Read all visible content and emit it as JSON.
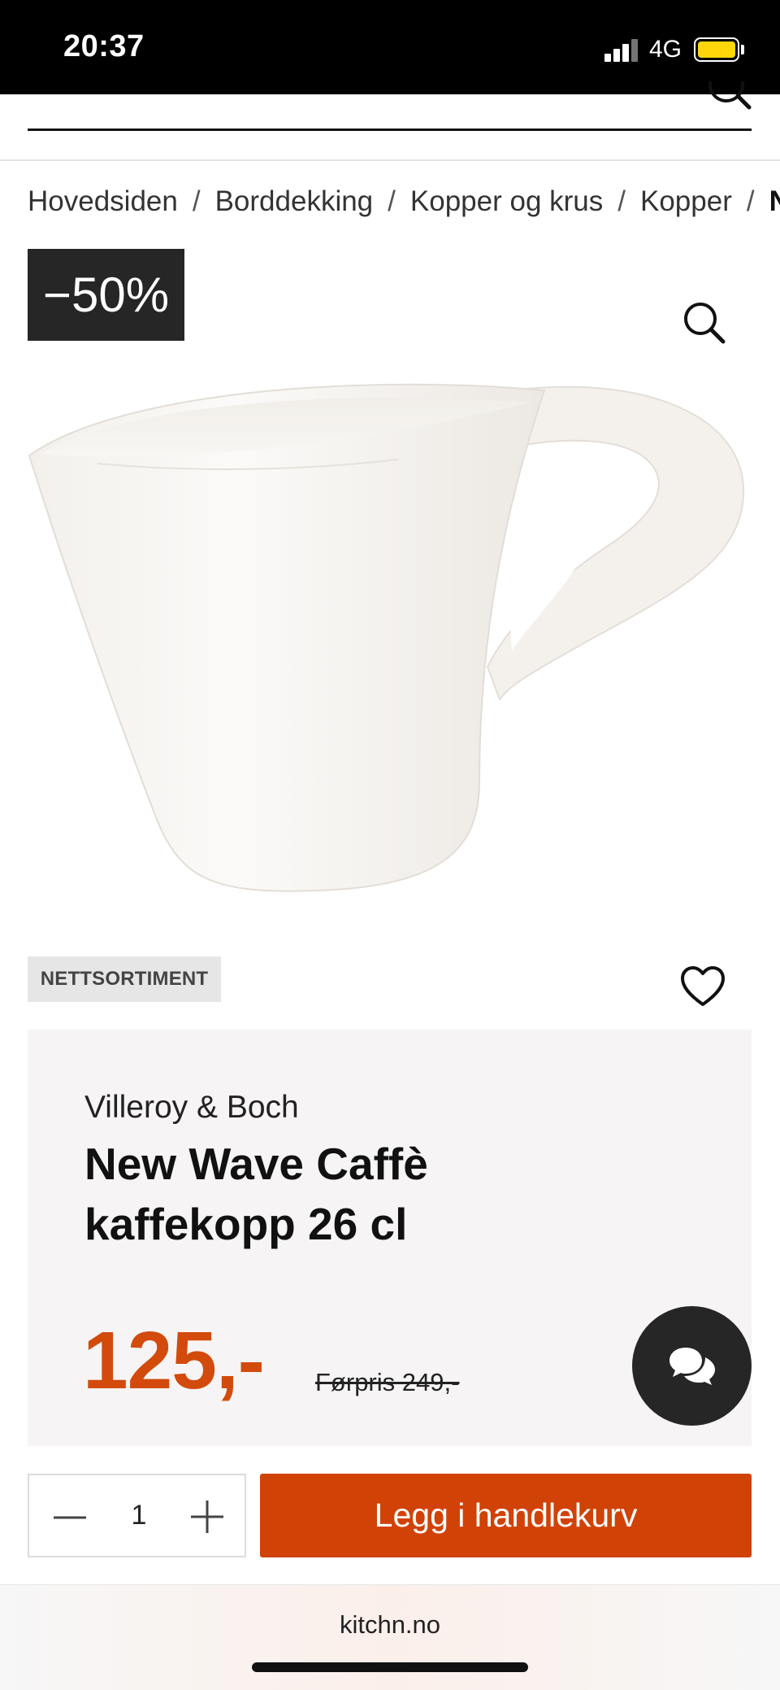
{
  "status_bar": {
    "time": "20:37",
    "network": "4G",
    "battery_color": "#ffd60a"
  },
  "breadcrumb": {
    "items": [
      "Hovedsiden",
      "Borddekking",
      "Kopper og krus",
      "Kopper",
      "N"
    ],
    "separator": "/"
  },
  "product": {
    "discount_badge": "−50%",
    "tag": "NETTSORTIMENT",
    "brand": "Villeroy & Boch",
    "title_line1": "New Wave Caffè",
    "title_line2": "kaffekopp 26 cl",
    "price": "125,-",
    "old_price": "Førpris 249,-"
  },
  "purchase": {
    "quantity": "1",
    "add_to_cart_label": "Legg i handlekurv"
  },
  "browser": {
    "url": "kitchn.no"
  },
  "icons": {
    "search": "search-icon",
    "zoom": "magnifier-icon",
    "favorite": "heart-icon",
    "chat": "chat-bubbles-icon",
    "minus": "minus-icon",
    "plus": "plus-icon"
  },
  "colors": {
    "accent": "#d14207",
    "price": "#d24b0c",
    "badge_bg": "#262626",
    "card_bg": "#f6f4f4"
  }
}
